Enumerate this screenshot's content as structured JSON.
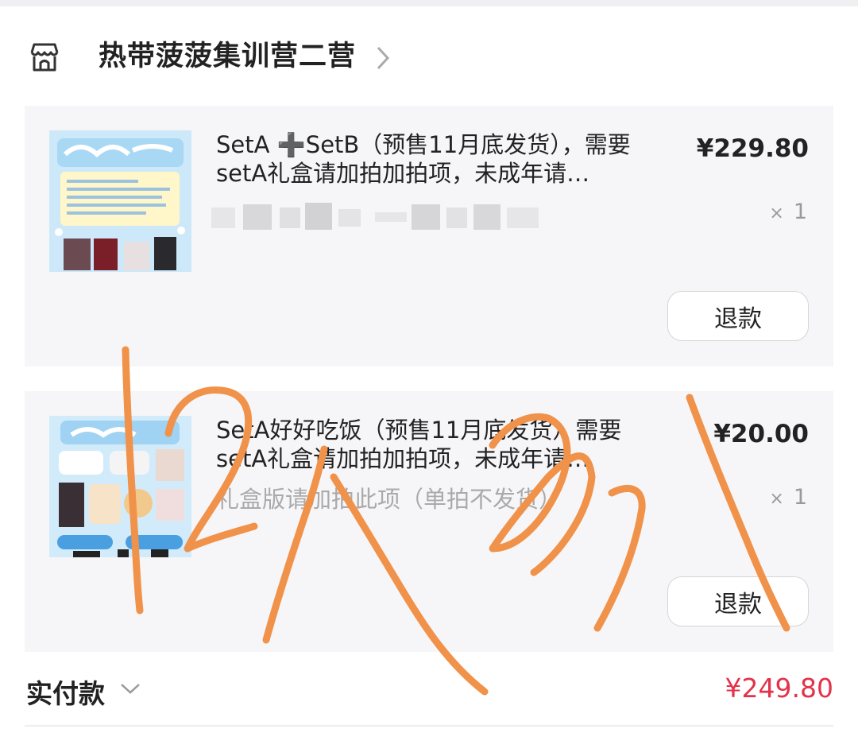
{
  "shop": {
    "name": "热带菠菠集训营二营",
    "icon": "shop-icon"
  },
  "items": [
    {
      "title": "SetA ➕SetB（预售11月底发货），需要setA礼盒请加拍加拍项，未成年请…",
      "price": "¥229.80",
      "qty_mark": "×",
      "qty": "1",
      "refund_label": "退款"
    },
    {
      "title": "SetA好好吃饭（预售11月底发货）需要setA礼盒请加拍加拍项，未成年请…",
      "spec": "礼盒版请加拍此项（单拍不发货）",
      "price": "¥20.00",
      "qty_mark": "×",
      "qty": "1",
      "refund_label": "退款"
    }
  ],
  "total": {
    "label": "实付款",
    "value": "¥249.80"
  },
  "colors": {
    "accent_red": "#e3324a",
    "card_bg": "#f6f6f8",
    "scribble": "#f0924a"
  }
}
